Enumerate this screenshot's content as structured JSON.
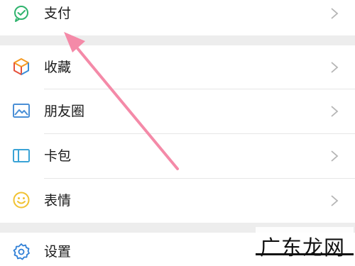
{
  "menu": {
    "items": [
      {
        "label": "支付",
        "icon": "wechat-pay-icon"
      },
      {
        "label": "收藏",
        "icon": "favorites-cube-icon"
      },
      {
        "label": "朋友圈",
        "icon": "moments-image-icon"
      },
      {
        "label": "卡包",
        "icon": "card-wallet-icon"
      },
      {
        "label": "表情",
        "icon": "smiley-icon"
      },
      {
        "label": "设置",
        "icon": "settings-gear-icon"
      }
    ]
  },
  "watermark": {
    "text": "广东龙网"
  },
  "colors": {
    "pay_green": "#2fb36d",
    "cube_orange": "#f59a23",
    "cube_blue": "#3b8ed8",
    "cube_red": "#e6513c",
    "moments_blue": "#4a8fd6",
    "card_blue": "#3aa3d6",
    "smiley_yellow": "#f1c232",
    "gear_blue": "#2f7fd6",
    "arrow_pink": "#f48aa8",
    "chevron_gray": "#b5b5b5",
    "separator_gray": "#ededed"
  }
}
